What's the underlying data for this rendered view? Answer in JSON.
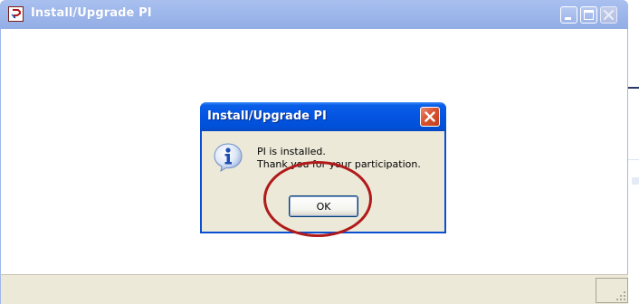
{
  "window": {
    "title": "Install/Upgrade PI"
  },
  "dialog": {
    "title": "Install/Upgrade PI",
    "message_line1": "PI is installed.",
    "message_line2": "Thank you for your participation.",
    "ok_label": "OK"
  },
  "icons": {
    "app": "app-icon",
    "minimize": "minimize-icon",
    "maximize": "maximize-icon",
    "close": "close-icon",
    "info": "info-icon",
    "resize_grip": "resize-grip-icon"
  },
  "colors": {
    "outer_titlebar": "#9fb8ec",
    "dialog_titlebar": "#0454e1",
    "dialog_body": "#ece9d8",
    "close_button": "#d9532f",
    "highlight_ring": "#b01a1a"
  }
}
